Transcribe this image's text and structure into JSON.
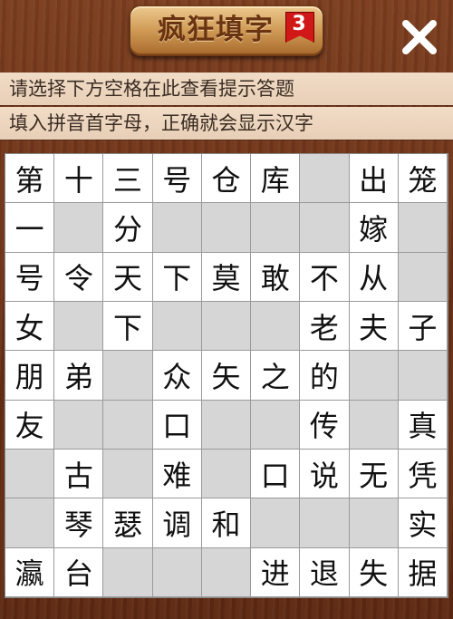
{
  "header": {
    "title": "疯狂填字",
    "level": "3",
    "close_symbol": "✕"
  },
  "hints": [
    "请选择下方空格在此查看提示答题",
    "填入拼音首字母，正确就会显示汉字"
  ],
  "colors": {
    "wood_dark": "#5c2812",
    "wood_light": "#7a3d1f",
    "hint_bg": "#f1dcc7",
    "cell_white": "#ffffff",
    "cell_empty": "#d6d6d6",
    "badge_red": "#d01818"
  },
  "board": {
    "rows": [
      [
        "第",
        "十",
        "三",
        "号",
        "仓",
        "库",
        "",
        "出",
        "笼"
      ],
      [
        "一",
        "",
        "分",
        "",
        "",
        "",
        "",
        "嫁",
        ""
      ],
      [
        "号",
        "令",
        "天",
        "下",
        "莫",
        "敢",
        "不",
        "从",
        ""
      ],
      [
        "女",
        "",
        "下",
        "",
        "",
        "",
        "老",
        "夫",
        "子"
      ],
      [
        "朋",
        "弟",
        "",
        "众",
        "矢",
        "之",
        "的",
        "",
        ""
      ],
      [
        "友",
        "",
        "",
        "口",
        "",
        "",
        "传",
        "",
        "真"
      ],
      [
        "",
        "古",
        "",
        "难",
        "",
        "口",
        "说",
        "无",
        "凭"
      ],
      [
        "",
        "琴",
        "瑟",
        "调",
        "和",
        "",
        "",
        "",
        "实"
      ],
      [
        "瀛",
        "台",
        "",
        "",
        "",
        "进",
        "退",
        "失",
        "据"
      ]
    ]
  }
}
